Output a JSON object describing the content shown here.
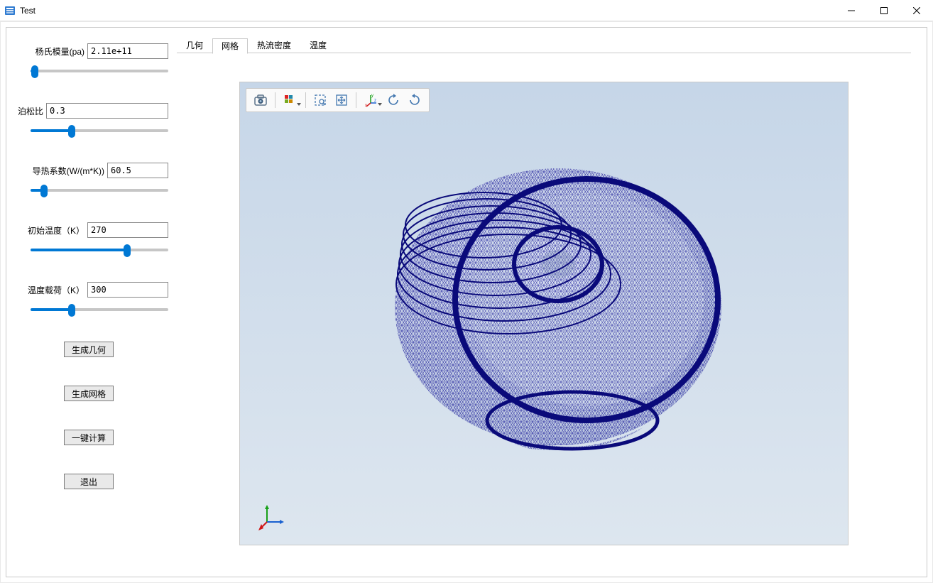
{
  "window": {
    "title": "Test"
  },
  "params": {
    "young": {
      "label": "杨氏模量(pa)",
      "value": "2.11e+11",
      "pos": 3
    },
    "poisson": {
      "label": "泊松比",
      "value": "0.3",
      "pos": 30
    },
    "conduct": {
      "label": "导热系数(W/(m*K))",
      "value": "60.5",
      "pos": 10
    },
    "inittemp": {
      "label": "初始温度（K）",
      "value": "270",
      "pos": 70
    },
    "loadtemp": {
      "label": "温度载荷（K）",
      "value": "300",
      "pos": 30
    }
  },
  "buttons": {
    "gen_geom": "生成几何",
    "gen_mesh": "生成网格",
    "compute": "一键计算",
    "exit": "退出"
  },
  "tabs": {
    "items": [
      "几何",
      "网格",
      "热流密度",
      "温度"
    ],
    "active_index": 1
  },
  "toolbar": {
    "screenshot": "camera-icon",
    "select_mode": "grid-icon",
    "zoom_box": "zoom-box-icon",
    "fit": "fit-icon",
    "axes": "axes-icon",
    "rot_cw": "rotate-cw-icon",
    "rot_ccw": "rotate-ccw-icon"
  }
}
